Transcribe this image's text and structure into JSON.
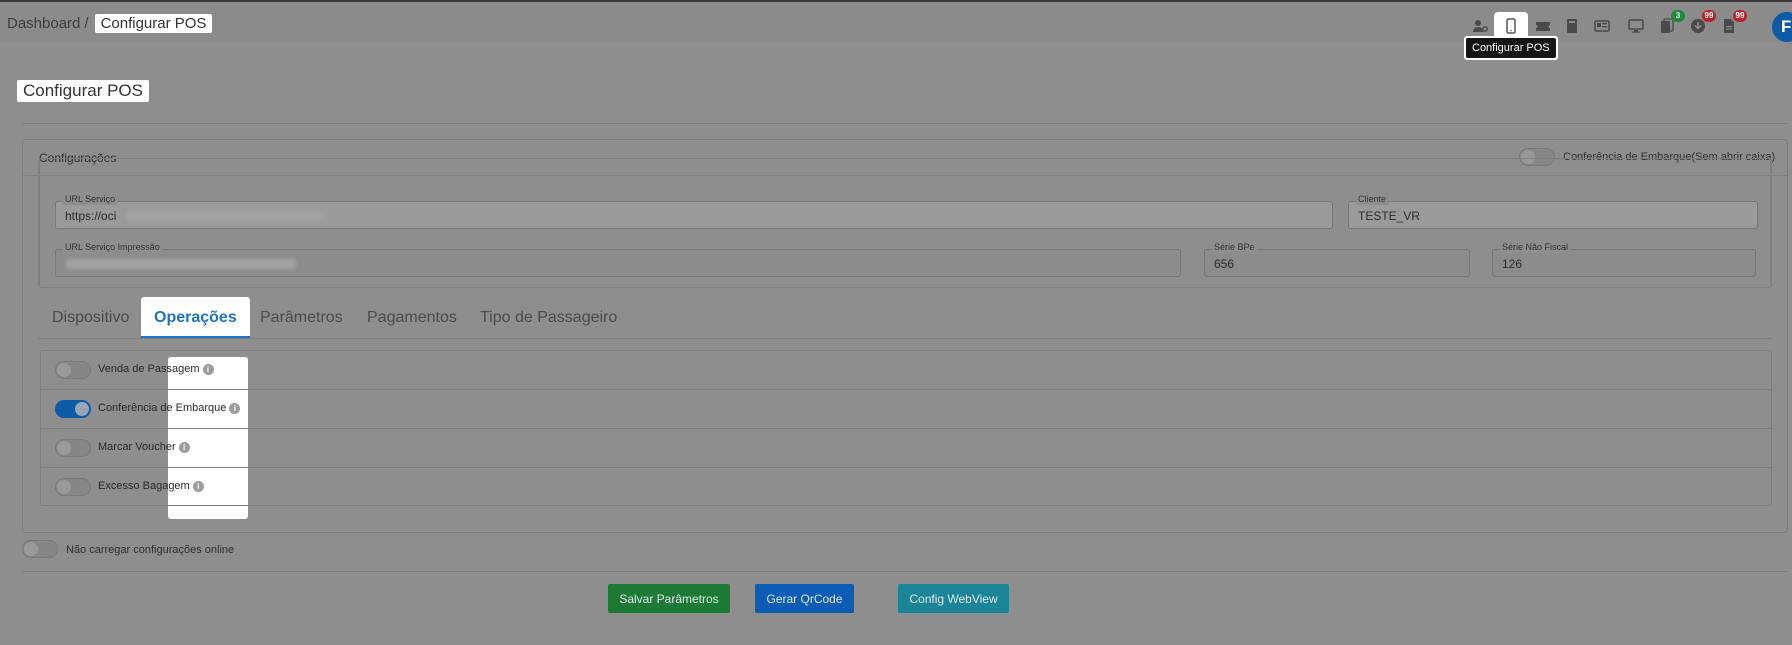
{
  "breadcrumb": {
    "root": "Dashboard",
    "separator": "/",
    "current": "Configurar POS"
  },
  "header": {
    "tooltip": "Configurar POS",
    "icons": [
      {
        "name": "user-gear-icon",
        "badge": ""
      },
      {
        "name": "mobile-icon",
        "badge": ""
      },
      {
        "name": "ticket-icon",
        "badge": ""
      },
      {
        "name": "book-icon",
        "badge": ""
      },
      {
        "name": "newspaper-icon",
        "badge": ""
      },
      {
        "name": "monitor-icon",
        "badge": ""
      },
      {
        "name": "documents-icon",
        "badge": "3"
      },
      {
        "name": "download-icon",
        "badge": "99"
      },
      {
        "name": "file-icon",
        "badge": "99"
      }
    ],
    "avatar_initial": "F",
    "badge_colors": {
      "green": "#1f8a3a",
      "red": "#b3262d"
    }
  },
  "page": {
    "title": "Configurar POS"
  },
  "config": {
    "title": "Configurações",
    "embark_toggle_label": "Conferência de Embarque(Sem abrir caixa)",
    "embark_toggle_on": false,
    "fields": {
      "url_service": {
        "label": "URL Serviço",
        "value": "https://oci"
      },
      "client": {
        "label": "Cliente",
        "value": "TESTE_VR"
      },
      "url_print": {
        "label": "URL Serviço Impressão",
        "value": ""
      },
      "serie_bpe": {
        "label": "Série BPe",
        "value": "656"
      },
      "serie_nf": {
        "label": "Série Não Fiscal",
        "value": "126"
      }
    }
  },
  "tabs": [
    {
      "label": "Dispositivo",
      "active": false
    },
    {
      "label": "Operações",
      "active": true
    },
    {
      "label": "Parâmetros",
      "active": false
    },
    {
      "label": "Pagamentos",
      "active": false
    },
    {
      "label": "Tipo de Passageiro",
      "active": false
    }
  ],
  "operations": [
    {
      "label": "Venda de Passagem",
      "on": false
    },
    {
      "label": "Conferência de Embarque",
      "on": true
    },
    {
      "label": "Marcar Voucher",
      "on": false
    },
    {
      "label": "Excesso Bagagem",
      "on": false
    }
  ],
  "offline_toggle": {
    "label": "Não carregar configurações online",
    "on": false
  },
  "buttons": {
    "save": "Salvar Parâmetros",
    "qrcode": "Gerar QrCode",
    "webview": "Config WebView"
  },
  "colors": {
    "accent": "#1c72c4",
    "save": "#1d7a35",
    "qrcode": "#0b5cb5",
    "webview": "#1a8596"
  }
}
